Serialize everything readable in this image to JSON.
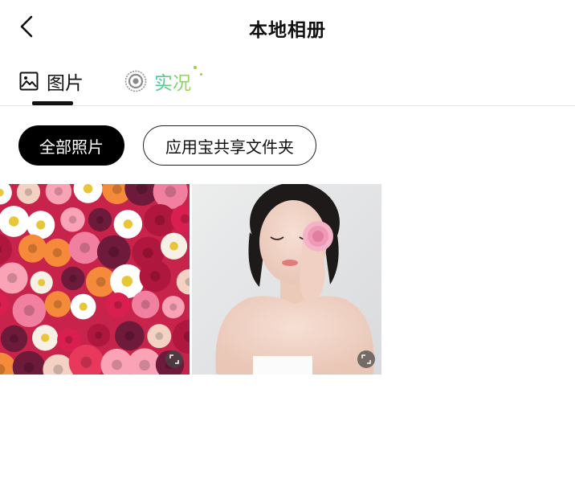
{
  "header": {
    "title": "本地相册",
    "back_icon": "chevron-left-icon"
  },
  "tabs": [
    {
      "label": "图片",
      "icon": "image-icon",
      "active": true
    },
    {
      "label": "实况",
      "icon": "live-photo-icon",
      "active": false
    }
  ],
  "filters": {
    "all_photos": "全部照片",
    "shared_folder": "应用宝共享文件夹",
    "selected": "全部照片"
  },
  "photos": [
    {
      "subject": "flower wall",
      "action_icon": "expand-icon"
    },
    {
      "subject": "woman holding pink flower",
      "action_icon": "expand-icon"
    }
  ],
  "colors": {
    "active_chip": "#000000",
    "live_gradient_start": "#39c9a7",
    "live_gradient_end": "#a6d64a",
    "divider": "#e6e6e6"
  }
}
